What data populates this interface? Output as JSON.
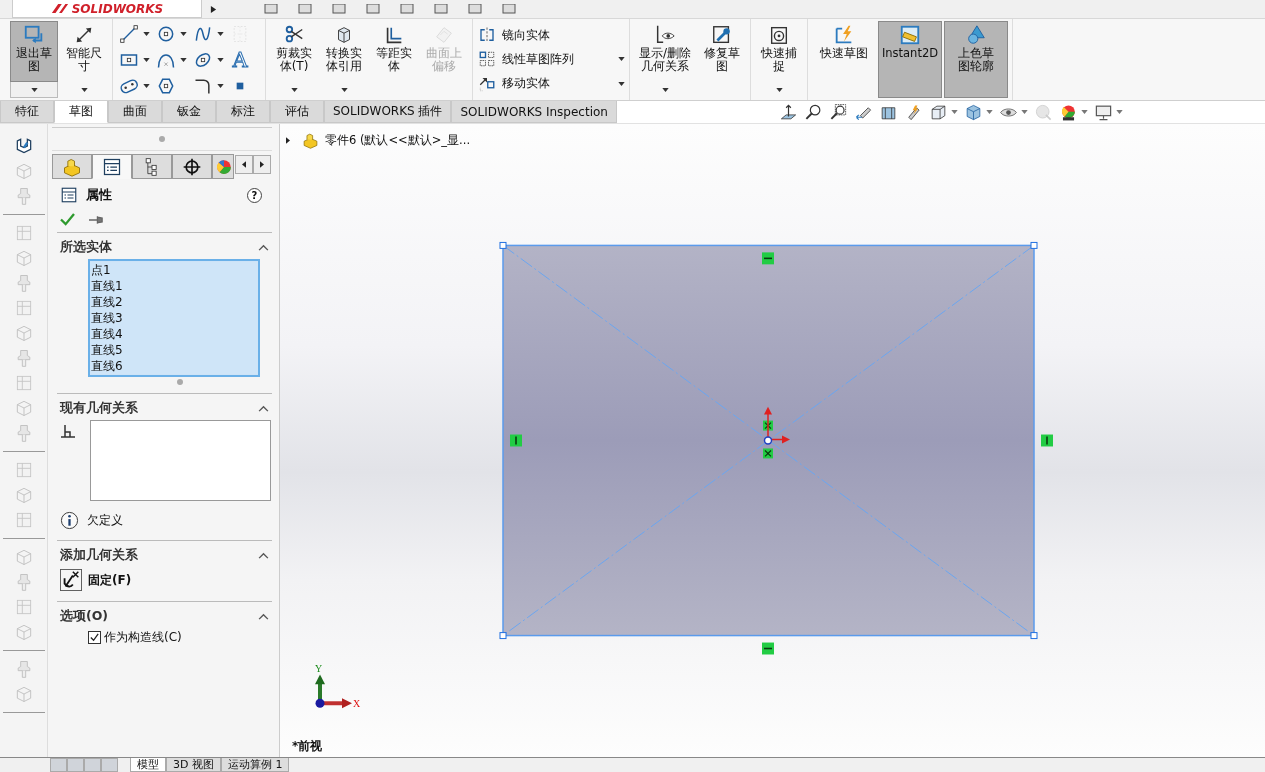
{
  "app": {
    "logo": "SOLIDWORKS"
  },
  "ribbon": {
    "groups": [
      {
        "kind": "buttons",
        "commands": [
          {
            "label": "退出草图",
            "selected": true,
            "disabled": false,
            "dropdown": true
          },
          {
            "label": "智能尺寸",
            "selected": false,
            "disabled": false,
            "dropdown": true
          }
        ]
      },
      {
        "kind": "grid",
        "commands": [
          {
            "dropdown": true,
            "disabled": false
          },
          {
            "dropdown": true,
            "disabled": false
          },
          {
            "dropdown": true,
            "disabled": false
          },
          {
            "dropdown": false,
            "disabled": true
          },
          {
            "dropdown": true,
            "disabled": false
          },
          {
            "dropdown": true,
            "disabled": false
          },
          {
            "dropdown": true,
            "disabled": false
          },
          {
            "glyph": "A",
            "dropdown": false,
            "disabled": false
          },
          {
            "dropdown": true,
            "disabled": false
          },
          {
            "dropdown": false,
            "disabled": false
          },
          {
            "dropdown": true,
            "disabled": false
          },
          {
            "dropdown": false,
            "disabled": false
          }
        ]
      },
      {
        "kind": "buttons",
        "commands": [
          {
            "label": "剪裁实体(T)",
            "selected": false,
            "disabled": false,
            "dropdown": true
          },
          {
            "label": "转换实体引用",
            "selected": false,
            "disabled": false,
            "dropdown": true
          },
          {
            "label": "等距实体",
            "selected": false,
            "disabled": false,
            "dropdown": false
          },
          {
            "label": "曲面上偏移",
            "selected": false,
            "disabled": true,
            "dropdown": false
          }
        ]
      },
      {
        "kind": "list",
        "commands": [
          {
            "label": "镜向实体",
            "dropdown": false
          },
          {
            "label": "线性草图阵列",
            "dropdown": true
          },
          {
            "label": "移动实体",
            "dropdown": true
          }
        ]
      },
      {
        "kind": "buttons",
        "commands": [
          {
            "label": "显示/删除几何关系",
            "selected": false,
            "disabled": false,
            "dropdown": true
          },
          {
            "label": "修复草图",
            "selected": false,
            "disabled": false,
            "dropdown": false
          }
        ]
      },
      {
        "kind": "buttons",
        "commands": [
          {
            "label": "快速捕捉",
            "selected": false,
            "disabled": false,
            "dropdown": true
          }
        ]
      },
      {
        "kind": "buttons",
        "commands": [
          {
            "label": "快速草图",
            "selected": false,
            "disabled": false,
            "dropdown": false
          },
          {
            "label": "Instant2D",
            "selected": true,
            "disabled": false,
            "dropdown": false
          },
          {
            "label": "上色草图轮廓",
            "selected": true,
            "disabled": false,
            "dropdown": false
          }
        ]
      }
    ]
  },
  "tabs": [
    {
      "label": "特征",
      "selected": false
    },
    {
      "label": "草图",
      "selected": true
    },
    {
      "label": "曲面",
      "selected": false
    },
    {
      "label": "钣金",
      "selected": false
    },
    {
      "label": "标注",
      "selected": false
    },
    {
      "label": "评估",
      "selected": false
    },
    {
      "label": "SOLIDWORKS 插件",
      "selected": false
    },
    {
      "label": "SOLIDWORKS Inspection",
      "selected": false
    }
  ],
  "panel_tabs": [
    {
      "selected": false
    },
    {
      "selected": true
    },
    {
      "selected": false
    },
    {
      "selected": false
    },
    {
      "selected": false
    }
  ],
  "property_manager": {
    "title": "属性",
    "help": "?",
    "sections": [
      {
        "kind": "entities",
        "title": "所选实体",
        "expanded": true,
        "items": [
          {
            "label": "点1",
            "selected": true
          },
          {
            "label": "直线1",
            "selected": true
          },
          {
            "label": "直线2",
            "selected": true
          },
          {
            "label": "直线3",
            "selected": true
          },
          {
            "label": "直线4",
            "selected": true
          },
          {
            "label": "直线5",
            "selected": true
          },
          {
            "label": "直线6",
            "selected": true
          }
        ]
      },
      {
        "kind": "relations",
        "title": "现有几何关系",
        "expanded": true,
        "status": "欠定义"
      },
      {
        "kind": "add",
        "title": "添加几何关系",
        "expanded": true,
        "buttons": [
          {
            "label": "固定(F)"
          }
        ]
      },
      {
        "kind": "options",
        "title": "选项(O)",
        "expanded": true,
        "options": [
          {
            "label": "作为构造线(C)",
            "checked": true
          }
        ]
      }
    ]
  },
  "canvas": {
    "tree_label": "零件6  (默认<<默认>_显...",
    "axis_x": "X",
    "axis_y": "Y",
    "view_label": "*前视"
  },
  "bottom_tabs": [
    {
      "label": "模型",
      "selected": true
    },
    {
      "label": "3D 视图",
      "selected": false
    },
    {
      "label": "运动算例 1",
      "selected": false
    }
  ]
}
